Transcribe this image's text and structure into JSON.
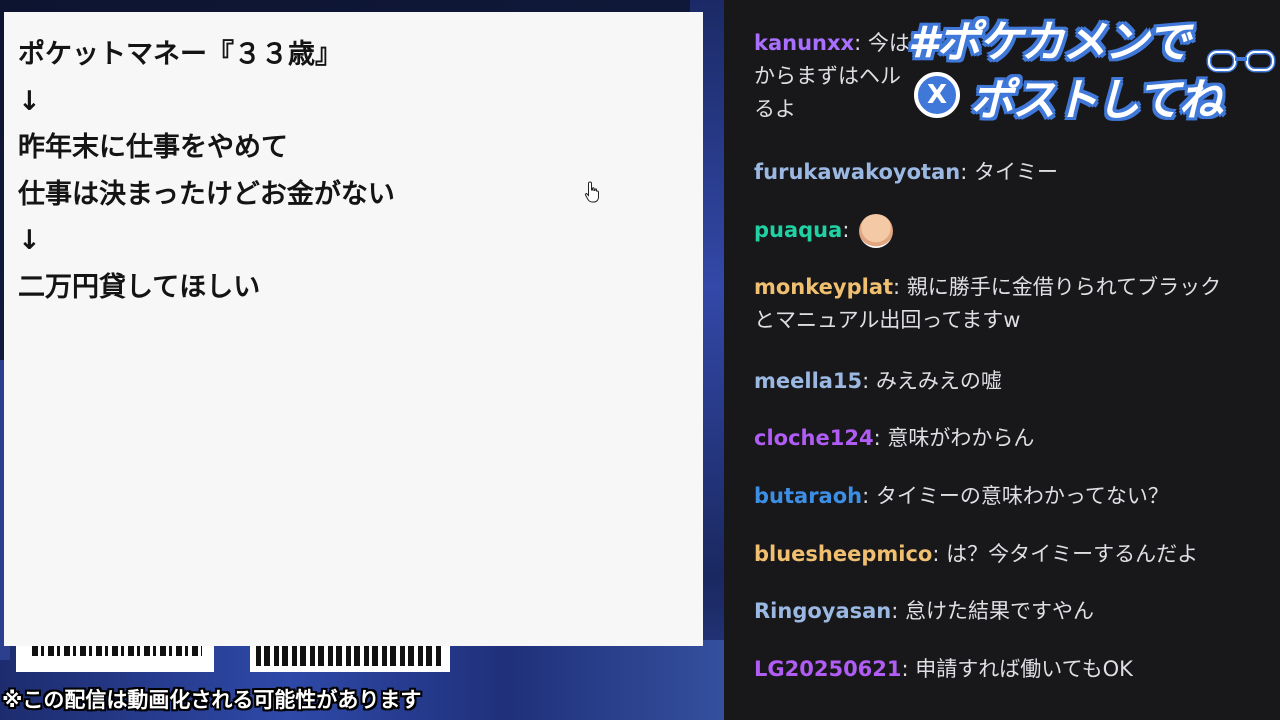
{
  "note": {
    "lines": [
      "ポケットマネー『３３歳』",
      "↓",
      "昨年末に仕事をやめて",
      "仕事は決まったけどお金がない",
      "↓",
      "二万円貸してほしい"
    ]
  },
  "disclaimer": "※この配信は動画化される可能性があります",
  "hashtag": {
    "line1": "#ポケカメンで",
    "line2": "ポストしてね",
    "badge": "X"
  },
  "chat": {
    "messages": [
      {
        "user": "kanunxx",
        "color": "#a970ff",
        "text": "今は",
        "continuation": [
          "からまずはヘル",
          "るよ"
        ]
      },
      {
        "user": "furukawakoyotan",
        "color": "#9bb8e3",
        "text": "タイミー"
      },
      {
        "user": "puaqua",
        "color": "#1fd1a3",
        "text": "",
        "emote": "face-emote"
      },
      {
        "user": "monkeyplat",
        "color": "#f0c070",
        "text": "親に勝手に金借りられてブラック",
        "continuation": [
          "とマニュアル出回ってますw"
        ]
      },
      {
        "user": "meella15",
        "color": "#9bb8e3",
        "text": "みえみえの嘘"
      },
      {
        "user": "cloche124",
        "color": "#b05cf5",
        "text": "意味がわからん"
      },
      {
        "user": "butaraoh",
        "color": "#3d8fe6",
        "text": "タイミーの意味わかってない？"
      },
      {
        "user": "bluesheepmico",
        "color": "#f0c070",
        "text": "は？今タイミーするんだよ"
      },
      {
        "user": "Ringoyasan",
        "color": "#9bb8e3",
        "text": "怠けた結果ですやん"
      },
      {
        "user": "LG20250621",
        "color": "#b05cf5",
        "text": "申請すれば働いてもOK"
      }
    ]
  }
}
